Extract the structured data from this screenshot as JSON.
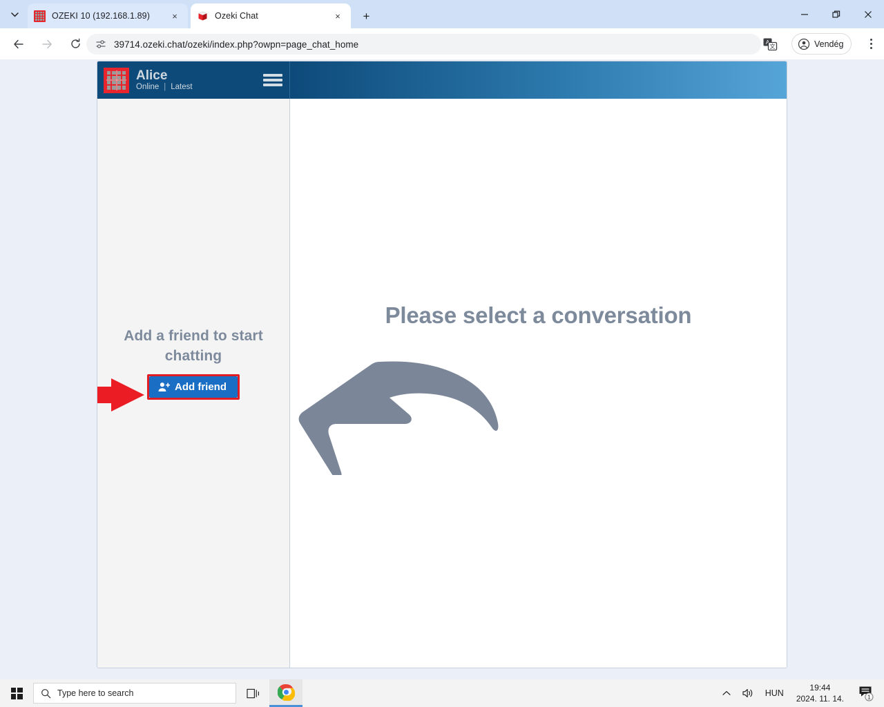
{
  "browser": {
    "tabs": [
      {
        "title": "OZEKI 10 (192.168.1.89)",
        "favicon": "ozeki-grid-icon",
        "active": false,
        "close_label": "×"
      },
      {
        "title": "Ozeki Chat",
        "favicon": "ozeki-cube-icon",
        "active": true,
        "close_label": "×"
      }
    ],
    "new_tab_label": "+",
    "tab_list_chevron": "⌄",
    "window_controls": {
      "minimize": "—",
      "maximize": "❐",
      "close": "✕"
    },
    "toolbar": {
      "back": "←",
      "forward": "→",
      "reload": "⟳",
      "site_settings_icon": "tune-icon",
      "url": "39714.ozeki.chat/ozeki/index.php?owpn=page_chat_home",
      "translate_icon": "translate-icon",
      "profile_label": "Vendég",
      "profile_icon": "account-circle-icon",
      "menu_icon": "kebab-menu-icon"
    }
  },
  "app": {
    "profile": {
      "avatar_icon": "ozeki-grid-avatar",
      "name": "Alice",
      "status": "Online",
      "separator": "|",
      "filter": "Latest",
      "menu_icon": "hamburger-menu-icon"
    },
    "sidebar": {
      "empty_title": "Add a friend to start chatting",
      "add_friend_label": "Add friend",
      "add_friend_icon": "person-add-icon",
      "highlight_color": "#e01c24",
      "button_color": "#1a6fc4",
      "annotation_arrow": "red-arrow-right-annotation"
    },
    "main": {
      "empty_title": "Please select a conversation",
      "arrow_icon": "curved-arrow-left-icon",
      "text_color": "#7d8a9c"
    },
    "header_gradient_from": "#0d4a7a",
    "header_gradient_to": "#56a5d8"
  },
  "taskbar": {
    "start_icon": "windows-start-icon",
    "search_placeholder": "Type here to search",
    "search_icon": "search-icon",
    "taskview_icon": "task-view-icon",
    "chrome_icon": "chrome-icon",
    "tray": {
      "show_hidden_icon": "chevron-up-icon",
      "volume_icon": "speaker-icon",
      "language": "HUN",
      "time": "19:44",
      "date": "2024. 11. 14.",
      "notification_icon": "notification-icon",
      "notification_count": "1"
    }
  }
}
